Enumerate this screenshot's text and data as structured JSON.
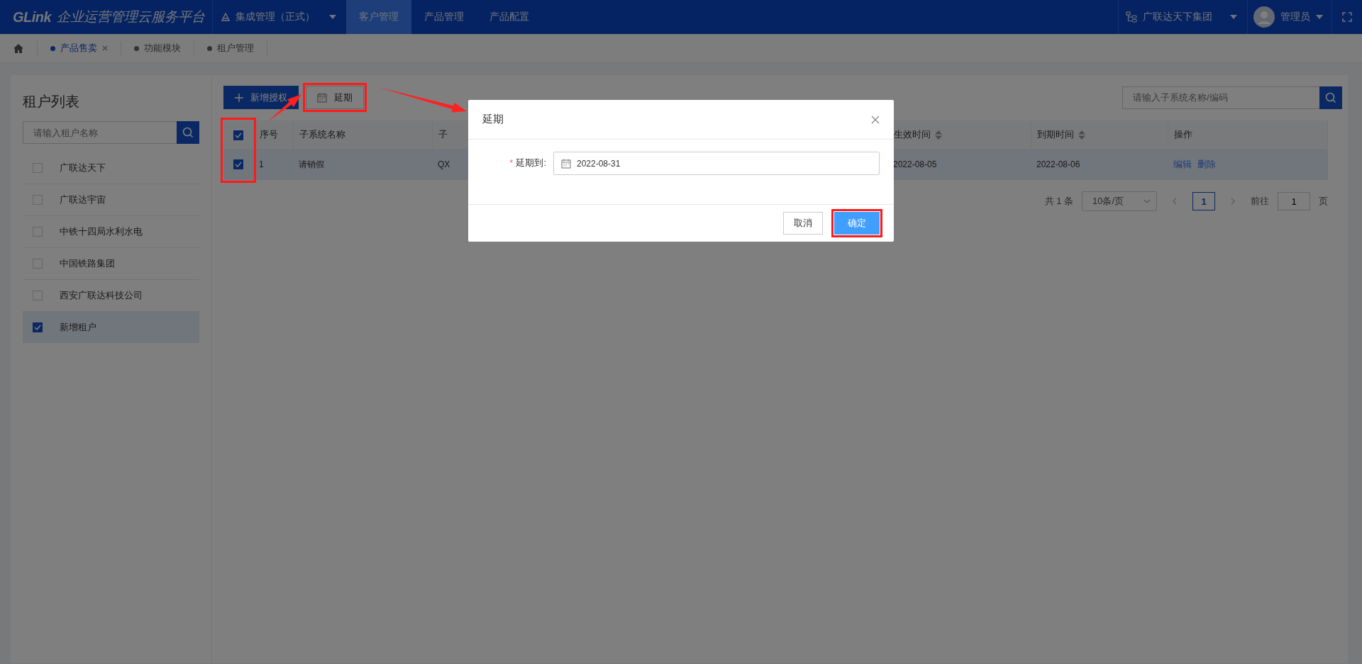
{
  "header": {
    "logo_mark": "GLink",
    "logo_text": "企业运营管理云服务平台",
    "system": "集成管理（正式）",
    "nav": [
      {
        "label": "客户管理",
        "selected": true
      },
      {
        "label": "产品管理",
        "selected": false
      },
      {
        "label": "产品配置",
        "selected": false
      }
    ],
    "organization": "广联达天下集团",
    "user": "管理员"
  },
  "tabs": [
    {
      "label": "产品售卖",
      "selected": true,
      "closable": true
    },
    {
      "label": "功能模块",
      "selected": false,
      "closable": false
    },
    {
      "label": "租户管理",
      "selected": false,
      "closable": false
    }
  ],
  "tenant_panel": {
    "title": "租户列表",
    "search": {
      "placeholder": "请输入租户名称"
    },
    "items": [
      {
        "label": "广联达天下",
        "checked": false
      },
      {
        "label": "广联达宇宙",
        "checked": false
      },
      {
        "label": "中铁十四局水利水电",
        "checked": false
      },
      {
        "label": "中国铁路集团",
        "checked": false
      },
      {
        "label": "西安广联达科技公司",
        "checked": false
      },
      {
        "label": "新增租户",
        "checked": true
      }
    ]
  },
  "toolbar": {
    "buttons": [
      {
        "kind": "primary",
        "label": "新增授权"
      },
      {
        "kind": "extend",
        "label": "延期",
        "highlighted": true,
        "arrow_to_dialog": true
      }
    ],
    "search": {
      "placeholder": "请输入子系统名称/编码"
    }
  },
  "table": {
    "all_checked": true,
    "select_column_highlighted": true,
    "arrow_to_extend": true,
    "columns": [
      {
        "label": "序号",
        "sortable": false
      },
      {
        "label": "子系统名称",
        "sortable": false
      },
      {
        "label": "子",
        "sortable": false
      },
      {
        "label": "生效时间",
        "sortable": true
      },
      {
        "label": "到期时间",
        "sortable": true
      },
      {
        "label": "操作",
        "sortable": false
      }
    ],
    "rows": [
      {
        "checked": true,
        "cells": [
          "1",
          "请销假",
          "QX",
          "2022-08-05",
          "2022-08-06"
        ],
        "actions": [
          "编辑",
          "删除"
        ]
      }
    ]
  },
  "pagination": {
    "total": "共 1 条",
    "page_size": "10条/页",
    "pages": [
      {
        "label": "1",
        "selected": true
      }
    ],
    "goto_label": "前往",
    "goto_value": "1",
    "page_unit": "页"
  },
  "dialog": {
    "title": "延期",
    "field": {
      "label": "延期到:",
      "required_mark": "*",
      "value": "2022-08-31"
    },
    "buttons": [
      {
        "kind": "default",
        "label": "取消"
      },
      {
        "kind": "primary",
        "label": "确定",
        "highlighted": true
      }
    ]
  }
}
